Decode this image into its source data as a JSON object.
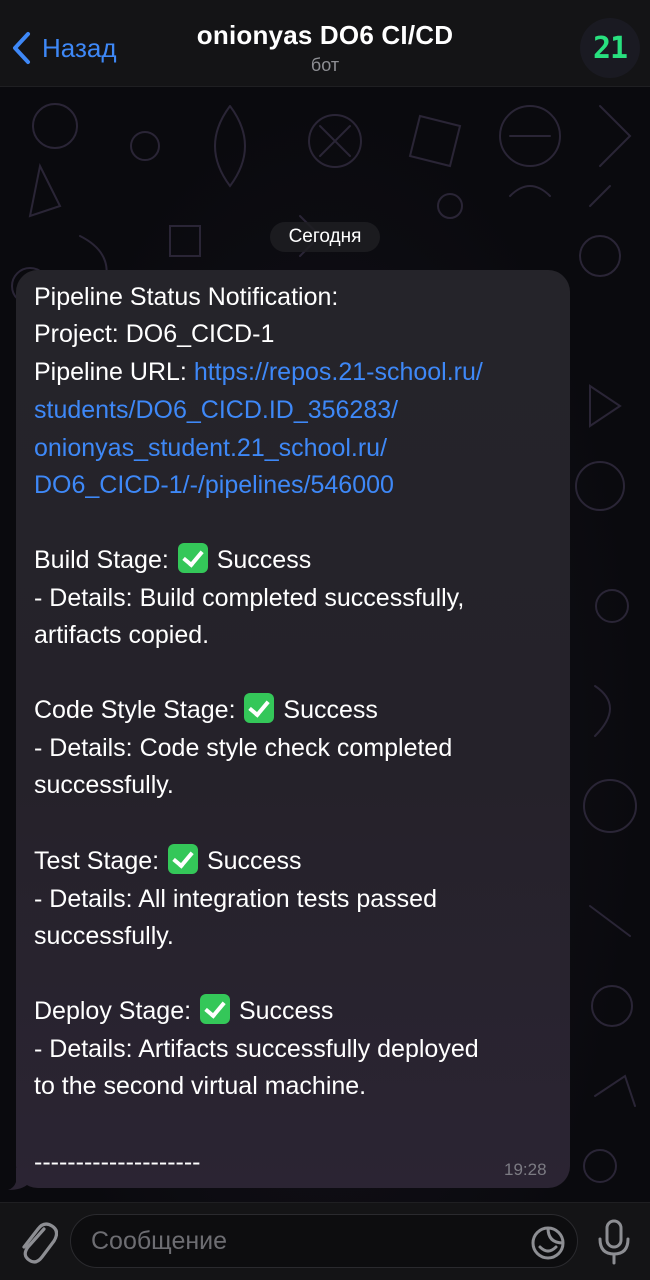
{
  "header": {
    "back_label": "Назад",
    "title": "onionyas DO6 CI/CD",
    "subtitle": "бот",
    "avatar_text": "21"
  },
  "date_chip": "Сегодня",
  "message": {
    "line_1": "Pipeline Status Notification:",
    "line_2": "Project: DO6_CICD-1",
    "url_prefix": "Pipeline URL: ",
    "url_line_1": "https://repos.21-school.ru/",
    "url_line_2": "students/DO6_CICD.ID_356283/",
    "url_line_3": "onionyas_student.21_school.ru/",
    "url_line_4": "DO6_CICD-1/-/pipelines/546000",
    "build_label": "Build Stage: ",
    "build_status": " Success",
    "build_details_1": "- Details: Build completed successfully,",
    "build_details_2": "artifacts copied.",
    "style_label": "Code Style Stage: ",
    "style_status": " Success",
    "style_details_1": "- Details: Code style check completed",
    "style_details_2": "successfully.",
    "test_label": "Test Stage: ",
    "test_status": " Success",
    "test_details_1": "- Details: All integration tests passed",
    "test_details_2": "successfully.",
    "deploy_label": "Deploy Stage: ",
    "deploy_status": " Success",
    "deploy_details_1": "- Details: Artifacts successfully deployed",
    "deploy_details_2": "to the second virtual machine.",
    "separator": "--------------------",
    "time": "19:28"
  },
  "input": {
    "placeholder": "Сообщение"
  },
  "icons": {
    "back": "chevron-left-icon",
    "attach": "paperclip-icon",
    "sticker": "sticker-icon",
    "mic": "microphone-icon",
    "status": "check-mark-button-icon"
  },
  "colors": {
    "accent": "#3e88f7",
    "success": "#34c759",
    "avatar_text": "#28e07f",
    "bubble": "#25242a"
  }
}
